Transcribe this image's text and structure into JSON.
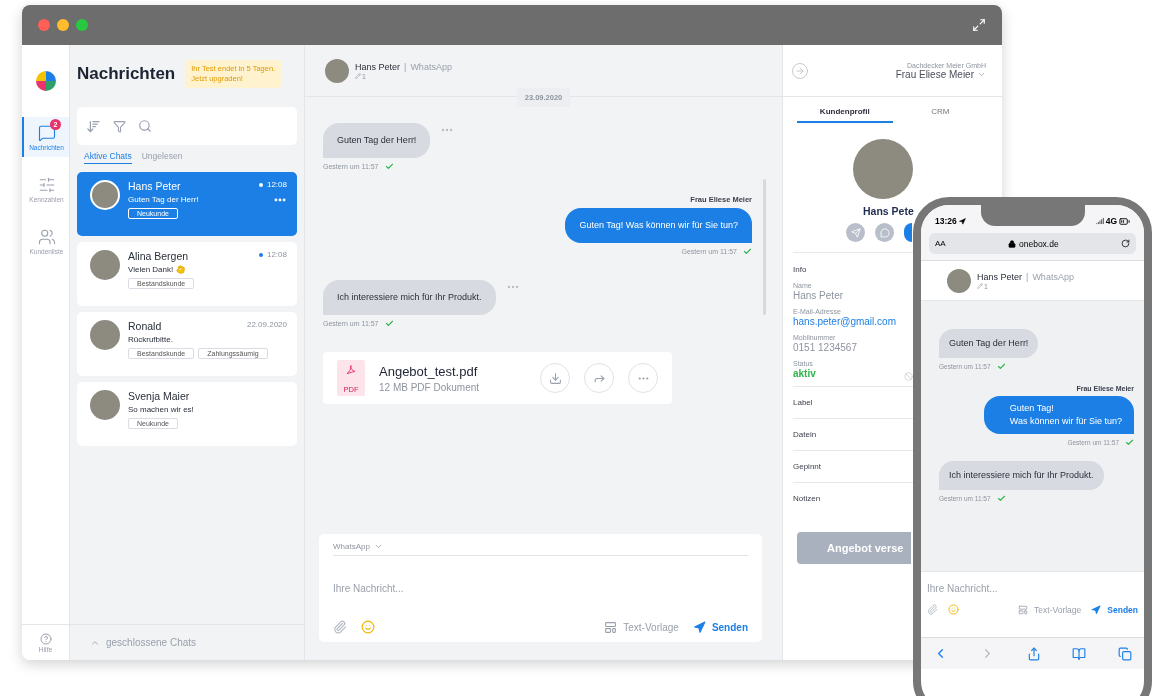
{
  "rail": {
    "items": [
      {
        "kind": "chat",
        "label": "Nachrichten",
        "badge": "2",
        "selected": true
      },
      {
        "kind": "sliders",
        "label": "Kennzahlen",
        "selected": false
      },
      {
        "kind": "users",
        "label": "Kundenliste",
        "selected": false
      }
    ],
    "help": "Hilfe"
  },
  "list": {
    "title": "Nachrichten",
    "trial_notice": [
      "Ihr Test endet in 5 Tagen.",
      "Jetzt upgraden!"
    ],
    "tabs": [
      {
        "label": "Aktive Chats",
        "selected": true
      },
      {
        "label": "Ungelesen",
        "selected": false
      }
    ],
    "chats": [
      {
        "name": "Hans Peter",
        "preview": "Guten Tag der Herr!",
        "time": "12:08",
        "unread": true,
        "selected": true,
        "wave": false,
        "tags": [
          "Neukunde"
        ]
      },
      {
        "name": "Alina Bergen",
        "preview": "Vielen Dank!",
        "time": "12:08",
        "unread": true,
        "selected": false,
        "wave": true,
        "tags": [
          "Bestandskunde"
        ]
      },
      {
        "name": "Ronald",
        "preview": "Rückrufbitte.",
        "time": "22.09.2020",
        "unread": false,
        "selected": false,
        "wave": false,
        "tags": [
          "Bestandskunde",
          "Zahlungssäumig"
        ]
      },
      {
        "name": "Svenja Maier",
        "preview": "So machen wir es!",
        "unread": false,
        "selected": false,
        "wave": false,
        "tags": [
          "Neukunde"
        ]
      }
    ],
    "closed_chats": "geschlossene Chats"
  },
  "chat": {
    "contact": "Hans Peter",
    "separator": "|",
    "channel": "WhatsApp",
    "pin_count": "1",
    "date": "23.09.2020",
    "messages": [
      {
        "kind": "in",
        "text": "Guten Tag der Herr!",
        "time": "Gestern um 11:57"
      },
      {
        "kind": "out",
        "sender": "Frau Eliese Meier",
        "text": "Guten Tag! Was können wir für Sie tun?",
        "time": "Gestern um 11:57"
      },
      {
        "kind": "in",
        "text": "Ich interessiere mich für Ihr Produkt.",
        "time": "Gestern um 11:57"
      },
      {
        "kind": "file",
        "name": "Angebot_test.pdf",
        "meta": "12 MB PDF Dokument",
        "file_type": "PDF"
      }
    ],
    "composer": {
      "channel": "WhatsApp",
      "placeholder": "Ihre Nachricht...",
      "template": "Text-Vorlage",
      "send": "Senden"
    }
  },
  "profile": {
    "company": "Dachdecker Meier GmbH",
    "agent": "Frau Eliese Meier",
    "tabs": [
      {
        "label": "Kundenprofil",
        "selected": true
      },
      {
        "label": "CRM",
        "selected": false
      }
    ],
    "name": "Hans Pete",
    "section": "Info",
    "fields": [
      {
        "kind": "text",
        "label": "Name",
        "value": "Hans Peter"
      },
      {
        "kind": "link",
        "label": "E-Mail-Adresse",
        "value": "hans.peter@gmail.com"
      },
      {
        "kind": "text",
        "label": "Mobilnummer",
        "value": "0151 1234567"
      },
      {
        "kind": "status",
        "label": "Status",
        "value": "aktiv"
      }
    ],
    "sections": [
      "Label",
      "Datein",
      "Gepinnt",
      "Notizen"
    ],
    "action": "Angebot verse"
  },
  "phone": {
    "time": "13:26",
    "network": "4G",
    "text_size": "AA",
    "url": "onebox.de",
    "contact": "Hans Peter",
    "separator": "|",
    "channel": "WhatsApp",
    "pin_count": "1",
    "messages": [
      {
        "kind": "in",
        "text": "Guten Tag der Herr!",
        "time": "Gestern um 11:57"
      },
      {
        "kind": "out",
        "sender": "Frau Eliese Meier",
        "text": "Guten Tag!\nWas können wir für Sie tun?",
        "time": "Gestern um 11:57"
      },
      {
        "kind": "in",
        "text": "Ich interessiere mich für Ihr Produkt.",
        "time": "Gestern um 11:57"
      }
    ],
    "placeholder": "Ihre Nachricht...",
    "template": "Text-Vorlage",
    "send": "Senden"
  }
}
